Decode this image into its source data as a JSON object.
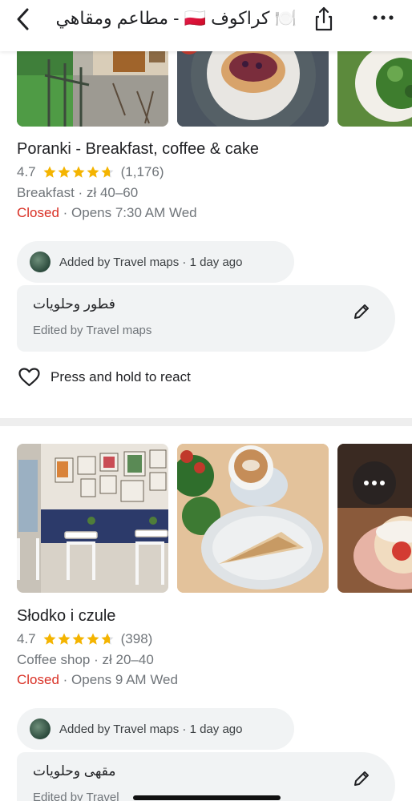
{
  "header": {
    "title": "🍽️ كراكوف 🇵🇱 - مطاعم ومقاهي",
    "back_icon": "chevron-left-icon",
    "share_icon": "share-icon",
    "more_icon": "more-horizontal-icon"
  },
  "places": [
    {
      "name": "Poranki - Breakfast, coffee & cake",
      "rating": "4.7",
      "reviews": "(1,176)",
      "stars_fill": 4.7,
      "category": "Breakfast",
      "price": "zł 40–60",
      "status": "Closed",
      "hours": "Opens 7:30 AM Wed",
      "added_by": "Added by Travel maps · 1 day ago",
      "note": "فطور وحلويات",
      "note_edited": "Edited by Travel maps",
      "react_label": "Press and hold to react"
    },
    {
      "name": "Słodko i czule",
      "rating": "4.7",
      "reviews": "(398)",
      "stars_fill": 4.7,
      "category": "Coffee shop",
      "price": "zł 20–40",
      "status": "Closed",
      "hours": "Opens 9 AM Wed",
      "added_by": "Added by Travel maps · 1 day ago",
      "note": "مقهى وحلويات",
      "note_edited": "Edited by Travel"
    }
  ],
  "colors": {
    "closed": "#d93025",
    "star": "#f4b400",
    "chip_bg": "#f1f3f4",
    "secondary_text": "#70757a"
  }
}
